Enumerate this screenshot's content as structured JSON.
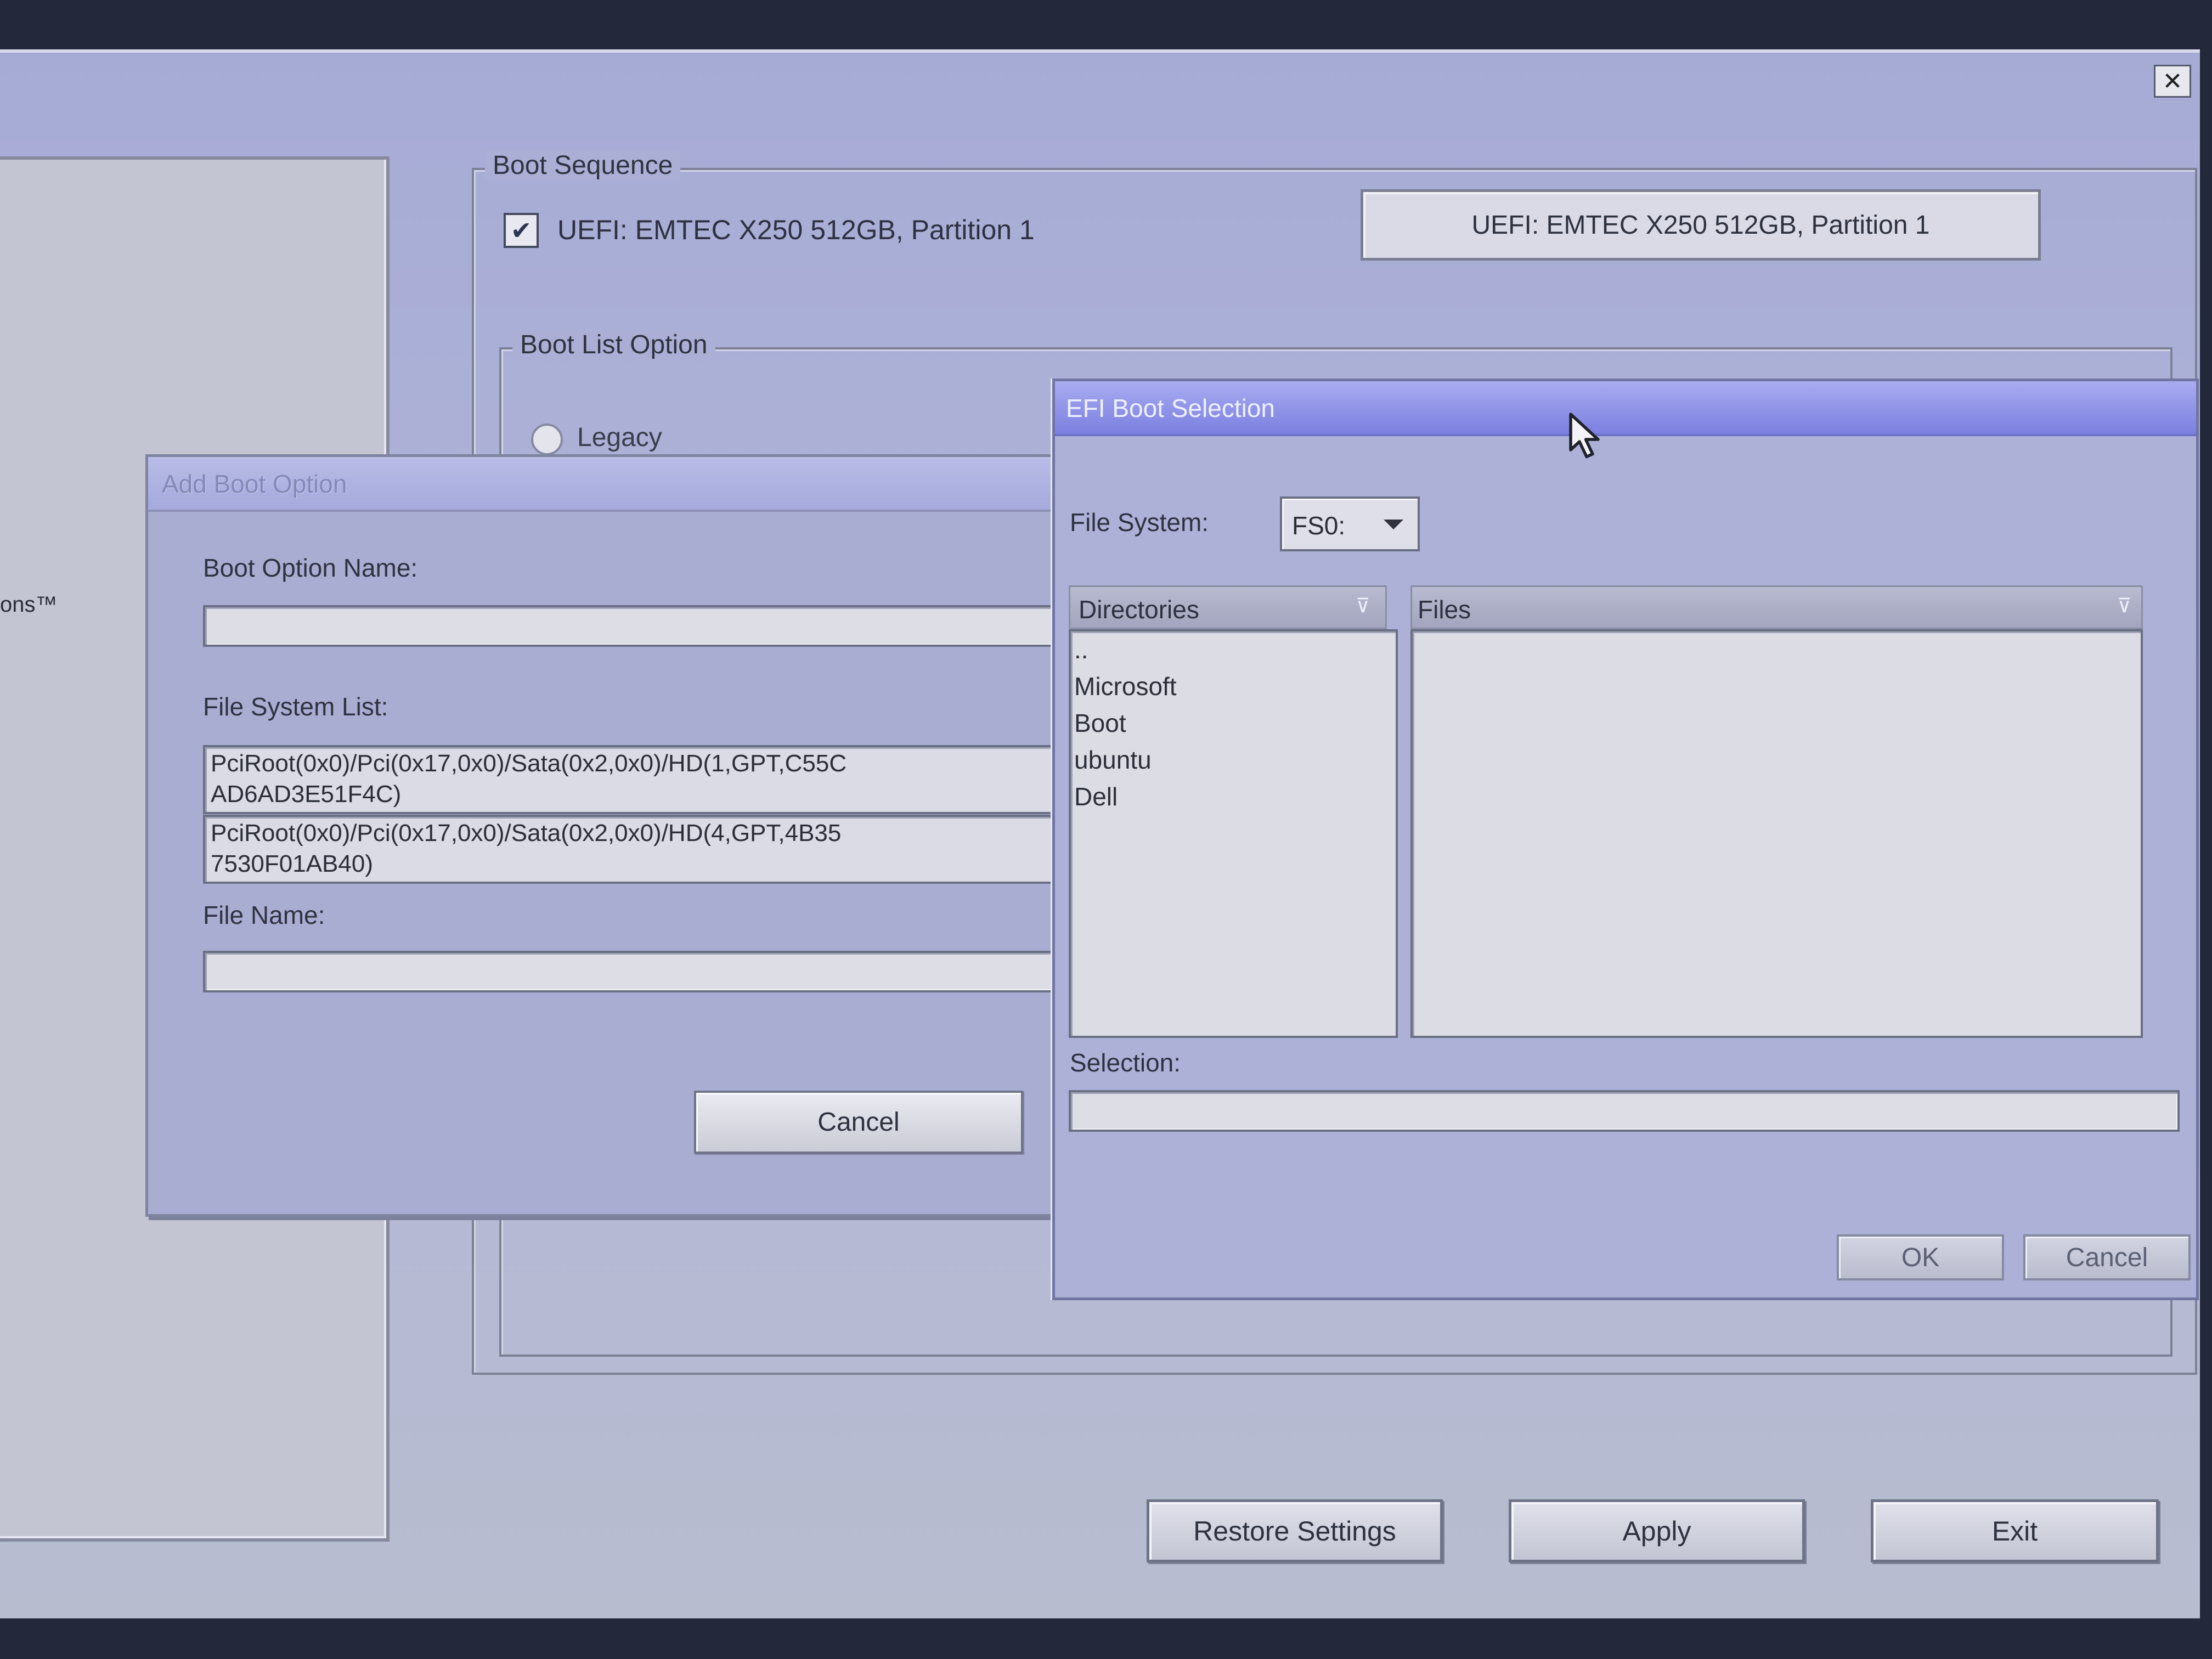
{
  "window": {
    "close_glyph": "✕"
  },
  "left_nav": {
    "fragment_text": "ons™"
  },
  "boot_sequence": {
    "legend": "Boot Sequence",
    "entry_checked": true,
    "entry_check_glyph": "✔",
    "entry_label": "UEFI: EMTEC X250 512GB, Partition 1",
    "selected_entry": "UEFI: EMTEC X250 512GB, Partition 1"
  },
  "boot_list_option": {
    "legend": "Boot List Option",
    "legacy_label": "Legacy"
  },
  "add_boot_option": {
    "title": "Add Boot Option",
    "name_label": "Boot Option Name:",
    "name_value": "",
    "fs_list_label": "File System List:",
    "fs_list": [
      {
        "line1": "PciRoot(0x0)/Pci(0x17,0x0)/Sata(0x2,0x0)/HD(1,GPT,C55C",
        "line2": "AD6AD3E51F4C)"
      },
      {
        "line1": "PciRoot(0x0)/Pci(0x17,0x0)/Sata(0x2,0x0)/HD(4,GPT,4B35",
        "line2": "7530F01AB40)"
      }
    ],
    "file_name_label": "File Name:",
    "file_name_value": "",
    "cancel_label": "Cancel"
  },
  "efi_boot_selection": {
    "title": "EFI Boot Selection",
    "file_system_label": "File System:",
    "file_system_value": "FS0:",
    "directories_header": "Directories",
    "files_header": "Files",
    "filter_icon_glyph": "⊽",
    "directories": [
      "..",
      "Microsoft",
      "Boot",
      "ubuntu",
      "Dell"
    ],
    "files": [],
    "selection_label": "Selection:",
    "selection_value": "",
    "ok_label": "OK",
    "cancel_label": "Cancel"
  },
  "footer": {
    "restore_label": "Restore Settings",
    "apply_label": "Apply",
    "exit_label": "Exit"
  },
  "icons": {
    "close": "close-icon",
    "checkbox": "checkmark-icon",
    "radio": "radio-button-icon",
    "dropdown": "chevron-down-icon",
    "filter": "filter-icon",
    "cursor": "mouse-pointer-icon"
  },
  "colors": {
    "efi_titlebar": "#7b7fe0",
    "window_background": "#b2b6d8",
    "disabled_title_text": "#8389b8"
  }
}
